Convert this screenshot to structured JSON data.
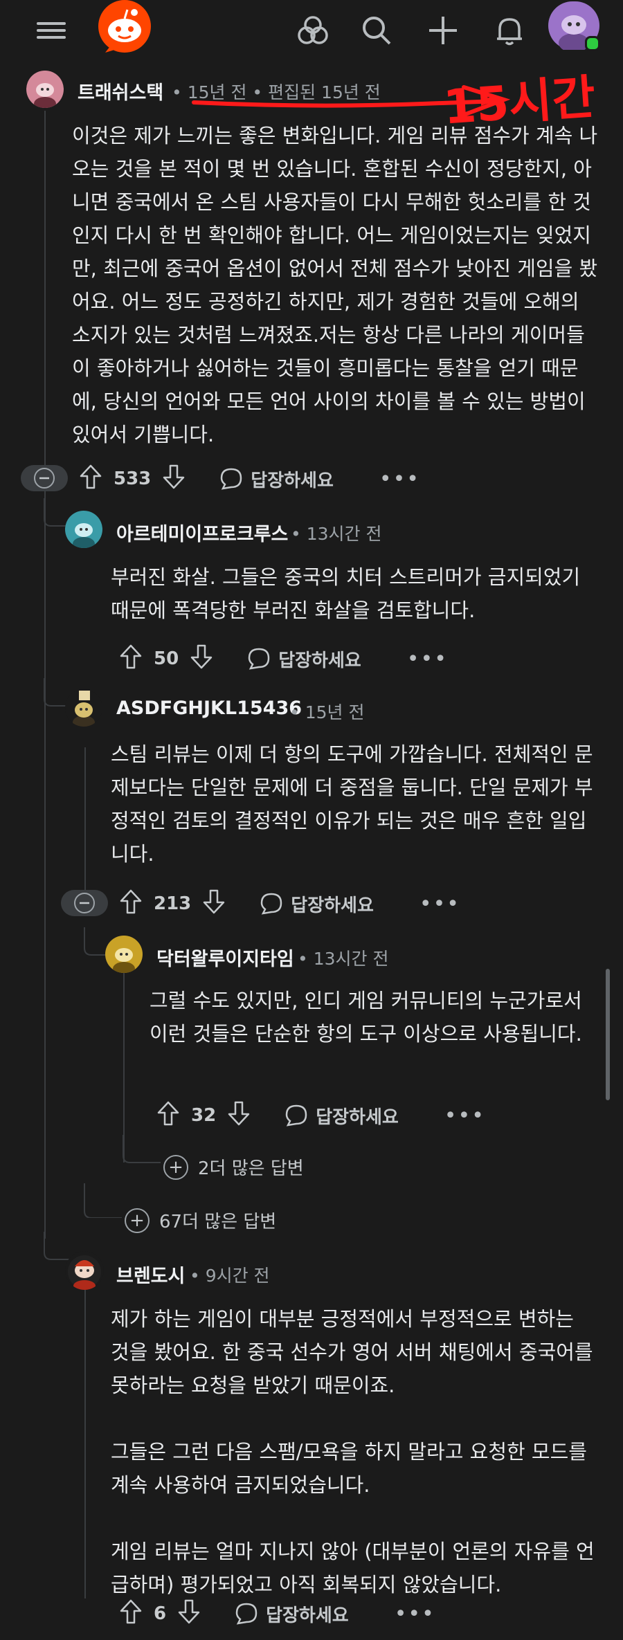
{
  "colors": {
    "background": "#1b1b1b",
    "brand": "#ff4500",
    "annotation": "#ff1a1a",
    "online": "#2ecc40"
  },
  "annotation": {
    "text": "15시간"
  },
  "comments": [
    {
      "author": "트래쉬스택",
      "meta": "• 15년 전 • 편집된 15년 전",
      "body": [
        "이것은 제가 느끼는 좋은 변화입니다. 게임 리뷰 점수가 계속 나오는 것을 본 적이 몇 번 있습니다. 혼합된 수신이 정당한지, 아니면 중국에서 온 스팀 사용자들이 다시 무해한 헛소리를 한 것인지 다시 한 번 확인해야 합니다. 어느 게임이었는지는 잊었지만, 최근에 중국어 옵션이 없어서 전체 점수가 낮아진 게임을 봤어요. 어느 정도 공정하긴 하지만, 제가 경험한 것들에 오해의 소지가 있는 것처럼 느껴졌죠.저는 항상 다른 나라의 게이머들이 좋아하거나 싫어하는 것들이 흥미롭다는 통찰을 얻기 때문에, 당신의 언어와 모든 언어 사이의 차이를 볼 수 있는 방법이 있어서 기쁩니다."
      ],
      "votes": "533",
      "reply_label": "답장하세요",
      "more_label": "•••"
    },
    {
      "author": "아르테미이프로크루스",
      "meta": "• 13시간 전",
      "body": [
        "부러진 화살. 그들은 중국의 치터 스트리머가 금지되었기 때문에 폭격당한 부러진 화살을 검토합니다."
      ],
      "votes": "50",
      "reply_label": "답장하세요",
      "more_label": "•••"
    },
    {
      "author": "ASDFGHJKL15436",
      "meta": "• 15년 전",
      "body": [
        "스팀 리뷰는 이제 더 항의 도구에 가깝습니다. 전체적인 문제보다는 단일한 문제에 더 중점을 둡니다. 단일 문제가 부정적인 검토의 결정적인 이유가 되는 것은 매우 흔한 일입니다."
      ],
      "votes": "213",
      "reply_label": "답장하세요",
      "more_label": "•••"
    },
    {
      "author": "닥터왈루이지타임",
      "meta": "• 13시간 전",
      "body": [
        "그럴 수도 있지만, 인디 게임 커뮤니티의 누군가로서 이런 것들은 단순한 항의 도구 이상으로 사용됩니다."
      ],
      "votes": "32",
      "reply_label": "답장하세요",
      "more_label": "•••"
    },
    {
      "author": "브렌도시",
      "meta": "• 9시간 전",
      "body": [
        "제가 하는 게임이 대부분 긍정적에서 부정적으로 변하는 것을 봤어요. 한 중국 선수가 영어 서버 채팅에서 중국어를 못하라는 요청을 받았기 때문이죠.",
        "그들은 그런 다음 스팸/모욕을 하지 말라고 요청한 모드를 계속 사용하여 금지되었습니다.",
        "게임 리뷰는 얼마 지나지 않아 (대부분이 언론의 자유를 언급하며) 평가되었고 아직 회복되지 않았습니다."
      ],
      "votes": "6",
      "reply_label": "답장하세요",
      "more_label": "•••"
    }
  ],
  "more_replies": [
    {
      "label": "2더 많은 답변"
    },
    {
      "label": "67더 많은 답변"
    }
  ]
}
